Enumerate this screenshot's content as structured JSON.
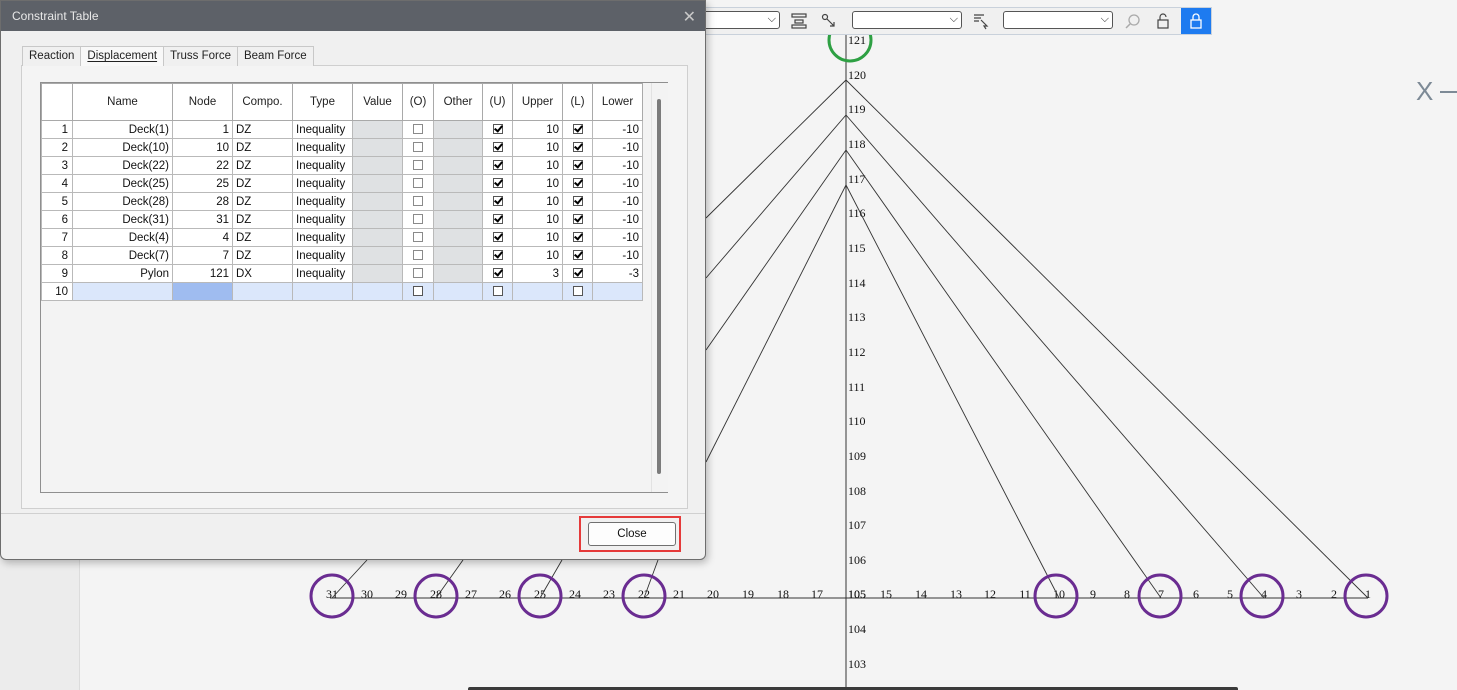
{
  "dialog": {
    "title": "Constraint Table",
    "close_glyph": "✕",
    "tabs": [
      {
        "label": "Reaction",
        "active": false
      },
      {
        "label": "Displacement",
        "active": true
      },
      {
        "label": "Truss Force",
        "active": false
      },
      {
        "label": "Beam Force",
        "active": false
      }
    ],
    "columns": [
      "",
      "Name",
      "Node",
      "Compo.",
      "Type",
      "Value",
      "(O)",
      "Other",
      "(U)",
      "Upper",
      "(L)",
      "Lower"
    ],
    "rows": [
      {
        "n": "1",
        "name": "Deck(1)",
        "node": "1",
        "comp": "DZ",
        "type": "Inequality",
        "value": "",
        "o": false,
        "other": "",
        "u": true,
        "upper": "10",
        "l": true,
        "lower": "-10"
      },
      {
        "n": "2",
        "name": "Deck(10)",
        "node": "10",
        "comp": "DZ",
        "type": "Inequality",
        "value": "",
        "o": false,
        "other": "",
        "u": true,
        "upper": "10",
        "l": true,
        "lower": "-10"
      },
      {
        "n": "3",
        "name": "Deck(22)",
        "node": "22",
        "comp": "DZ",
        "type": "Inequality",
        "value": "",
        "o": false,
        "other": "",
        "u": true,
        "upper": "10",
        "l": true,
        "lower": "-10"
      },
      {
        "n": "4",
        "name": "Deck(25)",
        "node": "25",
        "comp": "DZ",
        "type": "Inequality",
        "value": "",
        "o": false,
        "other": "",
        "u": true,
        "upper": "10",
        "l": true,
        "lower": "-10"
      },
      {
        "n": "5",
        "name": "Deck(28)",
        "node": "28",
        "comp": "DZ",
        "type": "Inequality",
        "value": "",
        "o": false,
        "other": "",
        "u": true,
        "upper": "10",
        "l": true,
        "lower": "-10"
      },
      {
        "n": "6",
        "name": "Deck(31)",
        "node": "31",
        "comp": "DZ",
        "type": "Inequality",
        "value": "",
        "o": false,
        "other": "",
        "u": true,
        "upper": "10",
        "l": true,
        "lower": "-10"
      },
      {
        "n": "7",
        "name": "Deck(4)",
        "node": "4",
        "comp": "DZ",
        "type": "Inequality",
        "value": "",
        "o": false,
        "other": "",
        "u": true,
        "upper": "10",
        "l": true,
        "lower": "-10"
      },
      {
        "n": "8",
        "name": "Deck(7)",
        "node": "7",
        "comp": "DZ",
        "type": "Inequality",
        "value": "",
        "o": false,
        "other": "",
        "u": true,
        "upper": "10",
        "l": true,
        "lower": "-10"
      },
      {
        "n": "9",
        "name": "Pylon",
        "node": "121",
        "comp": "DX",
        "type": "Inequality",
        "value": "",
        "o": false,
        "other": "",
        "u": true,
        "upper": "3",
        "l": true,
        "lower": "-3"
      }
    ],
    "new_row_number": "10",
    "close_button": "Close"
  },
  "canvas": {
    "axis_label": "X",
    "tower_labels": [
      "121",
      "120",
      "119",
      "118",
      "117",
      "116",
      "115",
      "114",
      "113",
      "112",
      "111",
      "110",
      "109",
      "108",
      "107",
      "106",
      "105",
      "104",
      "103"
    ],
    "deck_labels": [
      "31",
      "30",
      "29",
      "28",
      "27",
      "26",
      "25",
      "24",
      "23",
      "22",
      "21",
      "20",
      "19",
      "18",
      "17",
      "15",
      "14",
      "13",
      "12",
      "11",
      "10",
      "9",
      "8",
      "7",
      "6",
      "5",
      "4",
      "3",
      "2",
      "1"
    ],
    "highlight_color_tower": "#2ea043",
    "highlight_color_deck": "#6a2c91"
  }
}
